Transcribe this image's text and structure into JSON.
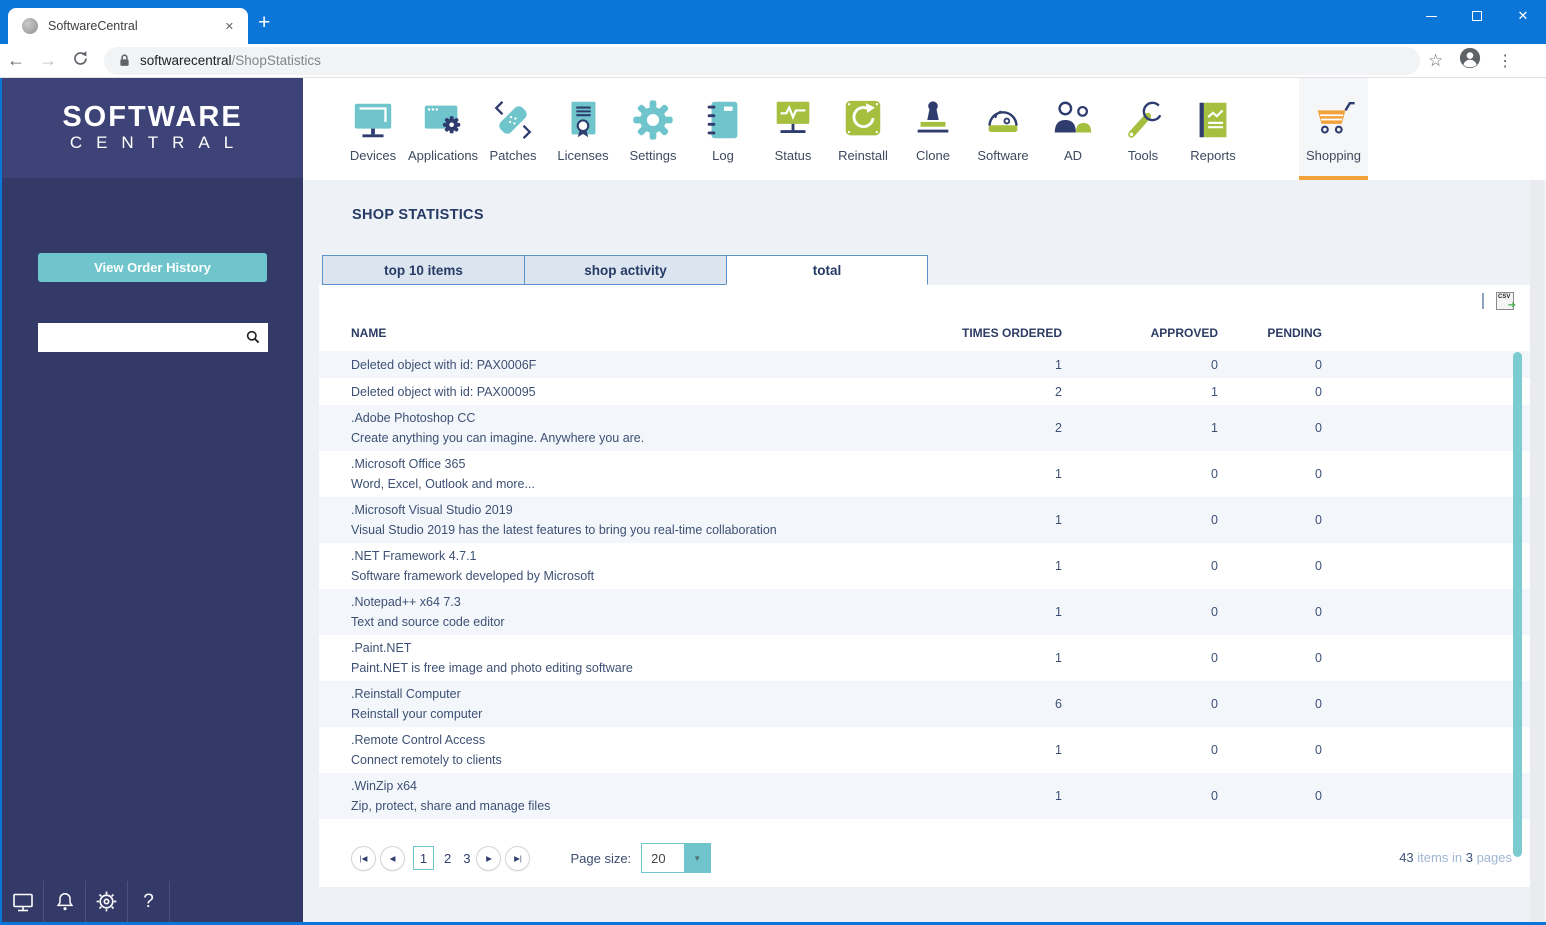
{
  "browser": {
    "tab_title": "SoftwareCentral",
    "url_host": "softwarecentral",
    "url_path": "/ShopStatistics",
    "glyphs": {
      "back": "←",
      "forward": "→",
      "plus": "+",
      "close": "✕",
      "menu": "⋮",
      "star": "☆"
    }
  },
  "sidebar": {
    "logo_line1": "SOFTWARE",
    "logo_line2": "CENTRAL",
    "order_history_button": "View Order History",
    "search_value": ""
  },
  "nav": {
    "items": [
      {
        "label": "Devices",
        "icon": "monitor-icon",
        "active": false
      },
      {
        "label": "Applications",
        "icon": "window-gear-icon",
        "active": false
      },
      {
        "label": "Patches",
        "icon": "bandage-icon",
        "active": false
      },
      {
        "label": "Licenses",
        "icon": "certificate-icon",
        "active": false
      },
      {
        "label": "Settings",
        "icon": "gear-icon",
        "active": false
      },
      {
        "label": "Log",
        "icon": "notebook-icon",
        "active": false
      },
      {
        "label": "Status",
        "icon": "pulse-monitor-icon",
        "active": false
      },
      {
        "label": "Reinstall",
        "icon": "refresh-square-icon",
        "active": false
      },
      {
        "label": "Clone",
        "icon": "stamp-icon",
        "active": false
      },
      {
        "label": "Software",
        "icon": "disc-icon",
        "active": false
      },
      {
        "label": "AD",
        "icon": "people-icon",
        "active": false
      },
      {
        "label": "Tools",
        "icon": "wrench-icon",
        "active": false
      },
      {
        "label": "Reports",
        "icon": "report-book-icon",
        "active": false
      },
      {
        "label": "Shopping",
        "icon": "cart-icon",
        "active": true
      }
    ]
  },
  "main": {
    "title": "SHOP STATISTICS",
    "tabs": [
      {
        "label": "top 10 items",
        "active": false
      },
      {
        "label": "shop activity",
        "active": false
      },
      {
        "label": "total",
        "active": true
      }
    ],
    "export_csv_label": "CSV",
    "export_csv_arrow": "➜",
    "table": {
      "columns": [
        "NAME",
        "TIMES ORDERED",
        "APPROVED",
        "PENDING"
      ],
      "rows": [
        {
          "name": "Deleted object with id: PAX0006F",
          "description": "",
          "times_ordered": "1",
          "approved": "0",
          "pending": "0"
        },
        {
          "name": "Deleted object with id: PAX00095",
          "description": "",
          "times_ordered": "2",
          "approved": "1",
          "pending": "0"
        },
        {
          "name": ".Adobe Photoshop CC",
          "description": "Create anything you can imagine. Anywhere you are.",
          "times_ordered": "2",
          "approved": "1",
          "pending": "0"
        },
        {
          "name": ".Microsoft Office 365",
          "description": "Word, Excel, Outlook and more...",
          "times_ordered": "1",
          "approved": "0",
          "pending": "0"
        },
        {
          "name": ".Microsoft Visual Studio 2019",
          "description": "Visual Studio 2019 has the latest features to bring you real-time collaboration",
          "times_ordered": "1",
          "approved": "0",
          "pending": "0"
        },
        {
          "name": ".NET Framework 4.7.1",
          "description": "Software framework developed by Microsoft",
          "times_ordered": "1",
          "approved": "0",
          "pending": "0"
        },
        {
          "name": ".Notepad++ x64 7.3",
          "description": "Text and source code editor",
          "times_ordered": "1",
          "approved": "0",
          "pending": "0"
        },
        {
          "name": ".Paint.NET",
          "description": "Paint.NET is free image and photo editing software",
          "times_ordered": "1",
          "approved": "0",
          "pending": "0"
        },
        {
          "name": ".Reinstall Computer",
          "description": "Reinstall your computer",
          "times_ordered": "6",
          "approved": "0",
          "pending": "0"
        },
        {
          "name": ".Remote Control Access",
          "description": "Connect remotely to clients",
          "times_ordered": "1",
          "approved": "0",
          "pending": "0"
        },
        {
          "name": ".WinZip x64",
          "description": "Zip, protect, share and manage files",
          "times_ordered": "1",
          "approved": "0",
          "pending": "0"
        }
      ]
    },
    "pagination": {
      "first": "|◀",
      "prev": "◀",
      "next": "▶",
      "last": "▶|",
      "pages": [
        "1",
        "2",
        "3"
      ],
      "current": "1",
      "page_size_label": "Page size:",
      "page_size": "20",
      "dropdown_arrow": "▼",
      "summary_count": "43",
      "summary_mid": "items in",
      "summary_pages": "3",
      "summary_tail": "pages"
    }
  },
  "colors": {
    "chrome_blue": "#0b76d8",
    "sidebar_navy": "#343a68",
    "accent_teal": "#6fc5cb",
    "accent_green": "#a7bf3f",
    "accent_navy": "#2f3c6e",
    "accent_orange": "#f2a23b"
  }
}
